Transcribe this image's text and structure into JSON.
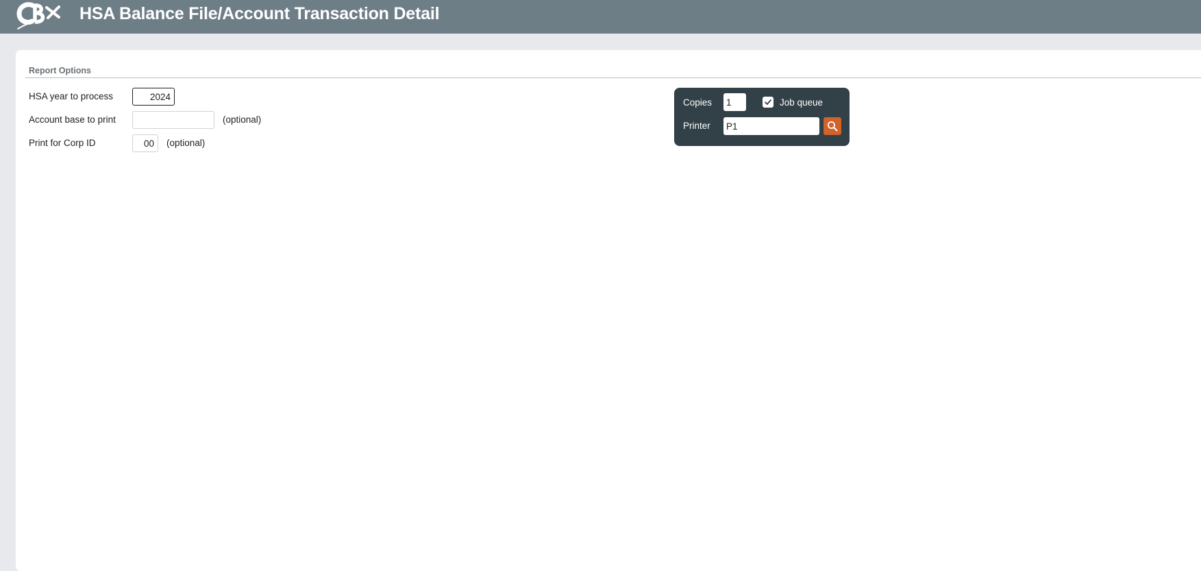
{
  "header": {
    "title": "HSA Balance File/Account Transaction Detail",
    "logo": "cbx-logo",
    "background_color": "#6e7e87"
  },
  "report_options": {
    "section_title": "Report Options",
    "fields": [
      {
        "label": "HSA year to process",
        "value": "2024",
        "hint": ""
      },
      {
        "label": "Account base to print",
        "value": "",
        "hint": "(optional)"
      },
      {
        "label": "Print for Corp ID",
        "value": "00",
        "hint": "(optional)"
      }
    ]
  },
  "print_settings": {
    "copies_label": "Copies",
    "copies_value": "1",
    "job_queue_label": "Job queue",
    "job_queue_checked": true,
    "printer_label": "Printer",
    "printer_value": "P1",
    "search_icon": "search-icon",
    "panel_color": "#324047",
    "button_color": "#d0622a"
  }
}
